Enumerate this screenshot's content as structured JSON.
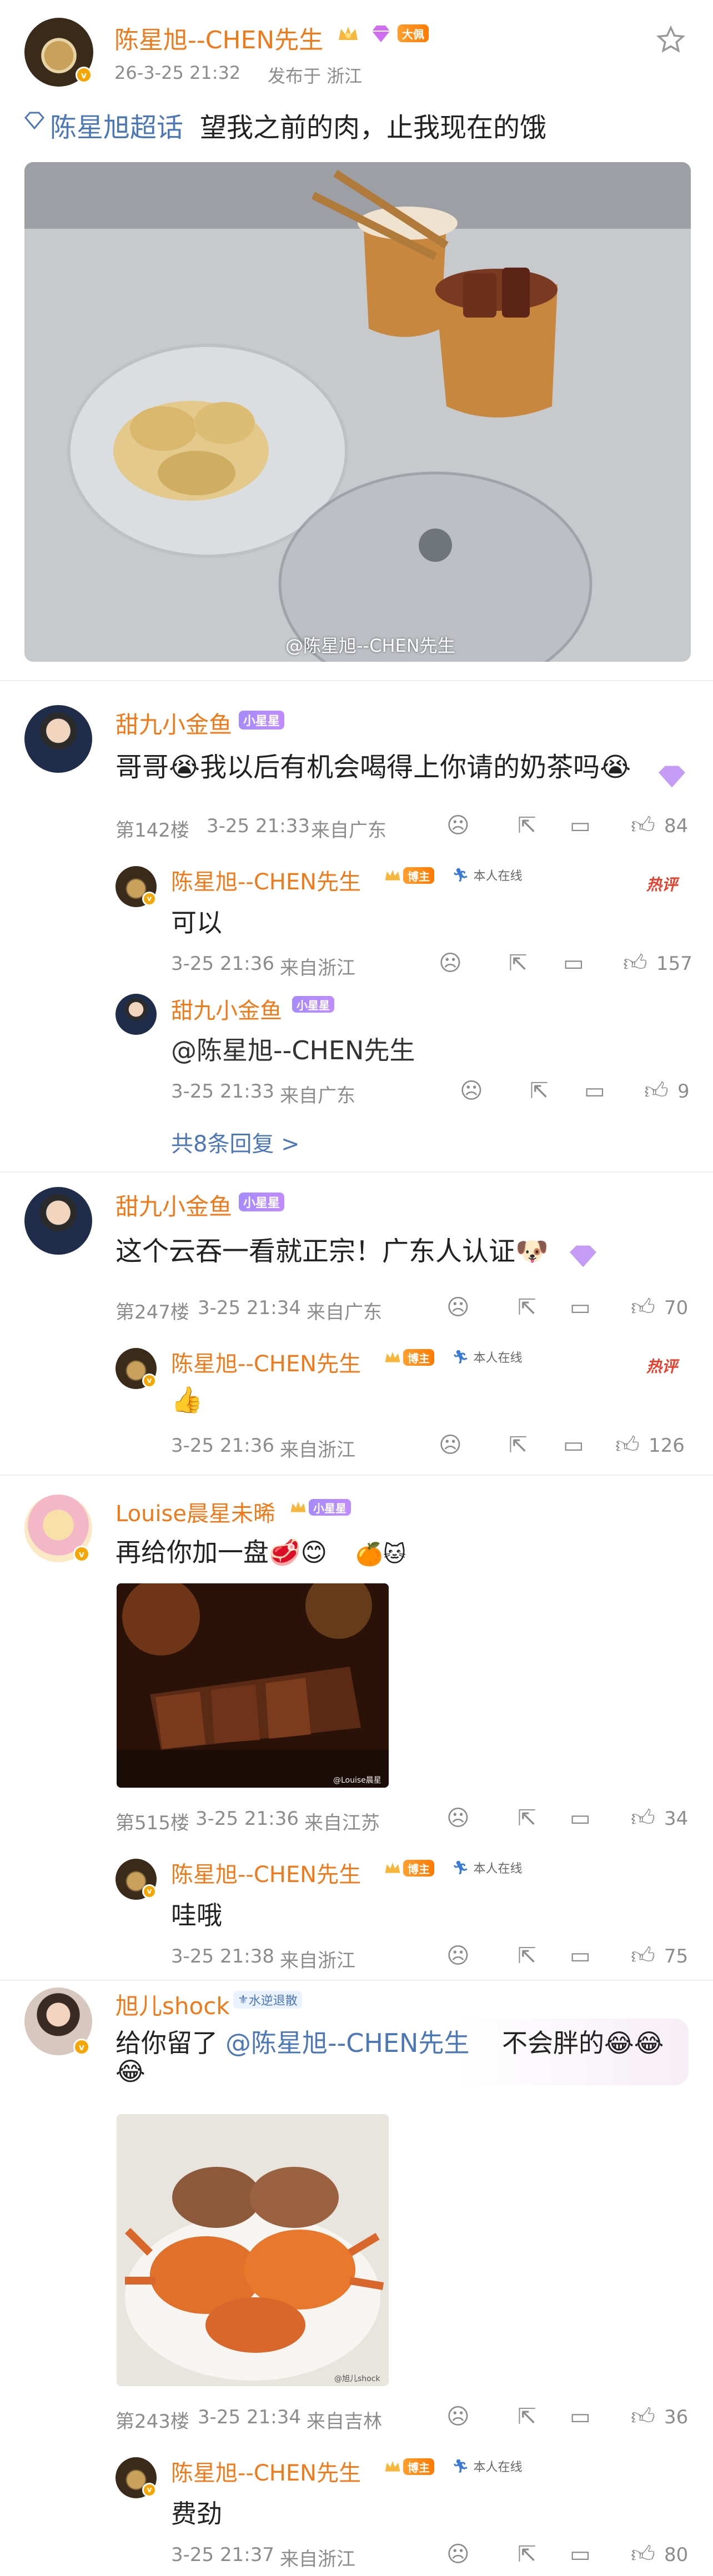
{
  "post": {
    "author": "陈星旭--CHEN先生",
    "badge_big": "大佩",
    "time": "26-3-25 21:32",
    "location": "发布于 浙江",
    "topic": "陈星旭超话",
    "text": "望我之前的肉，止我现在的饿",
    "watermark": "@陈星旭--CHEN先生"
  },
  "comments": [
    {
      "user": "甜九小金鱼",
      "level": "小星星",
      "text": "哥哥😭我以后有机会喝得上你请的奶茶吗😭",
      "floor": "第142楼",
      "time": "3-25 21:33",
      "from": "来自广东",
      "likes": "84",
      "replies": [
        {
          "user": "陈星旭--CHEN先生",
          "level": "博主",
          "online": "本人在线",
          "hot": "热评",
          "text": "可以",
          "time": "3-25 21:36",
          "from": "来自浙江",
          "likes": "157"
        },
        {
          "user": "甜九小金鱼",
          "level": "小星星",
          "text": "@陈星旭--CHEN先生",
          "time": "3-25 21:33",
          "from": "来自广东",
          "likes": "9"
        }
      ],
      "more": "共8条回复 >"
    },
    {
      "user": "甜九小金鱼",
      "level": "小星星",
      "text": "这个云吞一看就正宗！广东人认证🐶",
      "floor": "第247楼",
      "time": "3-25 21:34",
      "from": "来自广东",
      "likes": "70",
      "replies": [
        {
          "user": "陈星旭--CHEN先生",
          "level": "博主",
          "online": "本人在线",
          "hot": "热评",
          "text": "👍",
          "time": "3-25 21:36",
          "from": "来自浙江",
          "likes": "126"
        }
      ]
    },
    {
      "user": "Louise晨星未晞",
      "level": "小星星",
      "text": "再给你加一盘🥩😊",
      "image_watermark": "@Louise晨星",
      "floor": "第515楼",
      "time": "3-25 21:36",
      "from": "来自江苏",
      "likes": "34",
      "replies": [
        {
          "user": "陈星旭--CHEN先生",
          "level": "博主",
          "online": "本人在线",
          "text": "哇哦",
          "time": "3-25 21:38",
          "from": "来自浙江",
          "likes": "75"
        }
      ]
    },
    {
      "user": "旭儿shock",
      "level": "水逆退散",
      "text1": "给你留了",
      "mention": "@陈星旭--CHEN先生",
      "text2": "不会胖的😂😂",
      "text3": "😂",
      "image_watermark": "@旭儿shock",
      "floor": "第243楼",
      "time": "3-25 21:34",
      "from": "来自吉林",
      "likes": "36",
      "replies": [
        {
          "user": "陈星旭--CHEN先生",
          "level": "博主",
          "online": "本人在线",
          "text": "费劲",
          "time": "3-25 21:37",
          "from": "来自浙江",
          "likes": "80"
        }
      ]
    }
  ]
}
